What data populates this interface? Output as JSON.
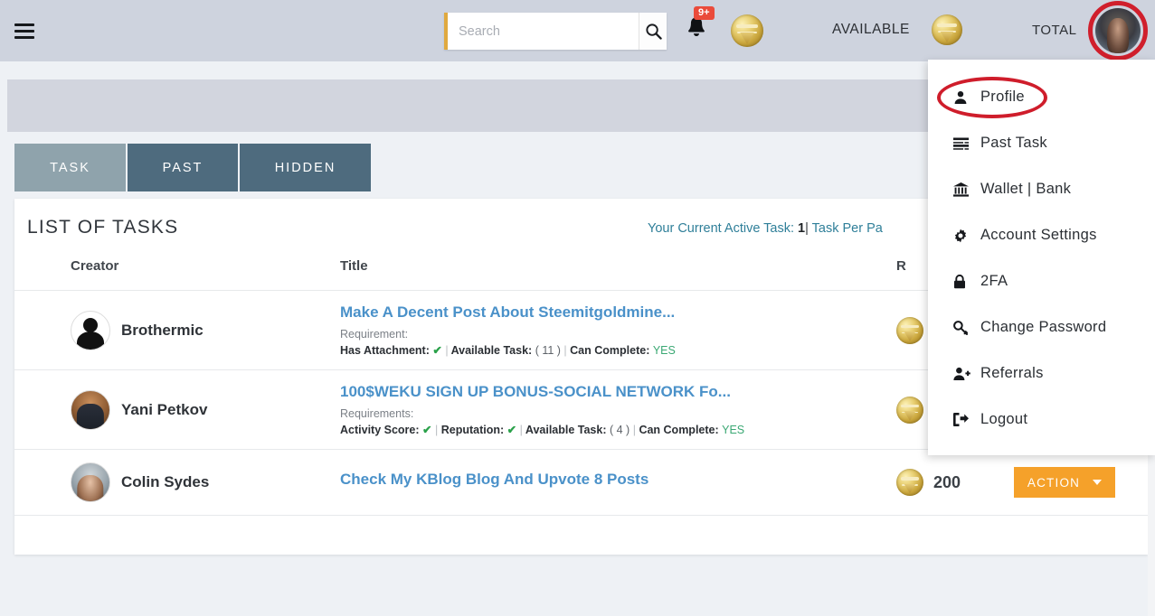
{
  "header": {
    "menu_icon": "hamburger-icon",
    "search": {
      "placeholder": "Search",
      "value": "",
      "button_icon": "search-icon"
    },
    "notifications": {
      "icon": "bell-icon",
      "badge": "9+"
    },
    "coin_balance_label": "",
    "available_label": "AVAILABLE",
    "total_label": "TOTAL",
    "avatar": "user-avatar",
    "highlight_color": "#d01f2c",
    "accent_color": "#e0a93f",
    "bar_color": "#ced3de"
  },
  "tabs": [
    {
      "label": "TASK",
      "active": true
    },
    {
      "label": "PAST",
      "active": false
    },
    {
      "label": "HIDDEN",
      "active": false
    }
  ],
  "card": {
    "title": "LIST OF TASKS",
    "meta_prefix": "Your Current Active Task:",
    "meta_count": "1",
    "meta_sep": "|",
    "meta_suffix": "Task Per Pa"
  },
  "table": {
    "columns": [
      "Creator",
      "Title",
      "R",
      ""
    ],
    "rows": [
      {
        "creator": "Brothermic",
        "avatar": "avatar-brothermic",
        "title": "Make A Decent Post About Steemitgoldmine...",
        "req_label": "Requirement:",
        "req_parts": [
          {
            "label": "Has Attachment:",
            "value": "✔",
            "kind": "tick"
          },
          {
            "label": "Available Task:",
            "value": "( 11 )",
            "kind": "num"
          },
          {
            "label": "Can Complete:",
            "value": "YES",
            "kind": "yes"
          }
        ],
        "reward": "",
        "reward_icon": "gold-coin-icon",
        "action_label": ""
      },
      {
        "creator": "Yani Petkov",
        "avatar": "avatar-yani-petkov",
        "title": "100$WEKU SIGN UP BONUS-SOCIAL NETWORK Fo...",
        "req_label": "Requirements:",
        "req_parts": [
          {
            "label": "Activity Score:",
            "value": "✔",
            "kind": "tick"
          },
          {
            "label": "Reputation:",
            "value": "✔",
            "kind": "tick"
          },
          {
            "label": "Available Task:",
            "value": "( 4 )",
            "kind": "num"
          },
          {
            "label": "Can Complete:",
            "value": "YES",
            "kind": "yes"
          }
        ],
        "reward": "",
        "reward_icon": "gold-coin-icon",
        "action_label": ""
      },
      {
        "creator": "Colin Sydes",
        "avatar": "avatar-colin-sydes",
        "title": "Check My KBlog Blog And Upvote 8 Posts",
        "req_label": "",
        "req_parts": [],
        "reward": "200",
        "reward_icon": "gold-coin-icon",
        "action_label": "ACTION"
      }
    ]
  },
  "dropdown": {
    "items": [
      {
        "label": "Profile",
        "icon": "user-icon",
        "highlighted": true
      },
      {
        "label": "Past Task",
        "icon": "list-icon",
        "highlighted": false
      },
      {
        "label": "Wallet | Bank",
        "icon": "bank-icon",
        "highlighted": false
      },
      {
        "label": "Account Settings",
        "icon": "gear-icon",
        "highlighted": false
      },
      {
        "label": "2FA",
        "icon": "lock-icon",
        "highlighted": false
      },
      {
        "label": "Change Password",
        "icon": "key-icon",
        "highlighted": false
      },
      {
        "label": "Referrals",
        "icon": "user-plus-icon",
        "highlighted": false
      },
      {
        "label": "Logout",
        "icon": "logout-icon",
        "highlighted": false
      }
    ]
  }
}
